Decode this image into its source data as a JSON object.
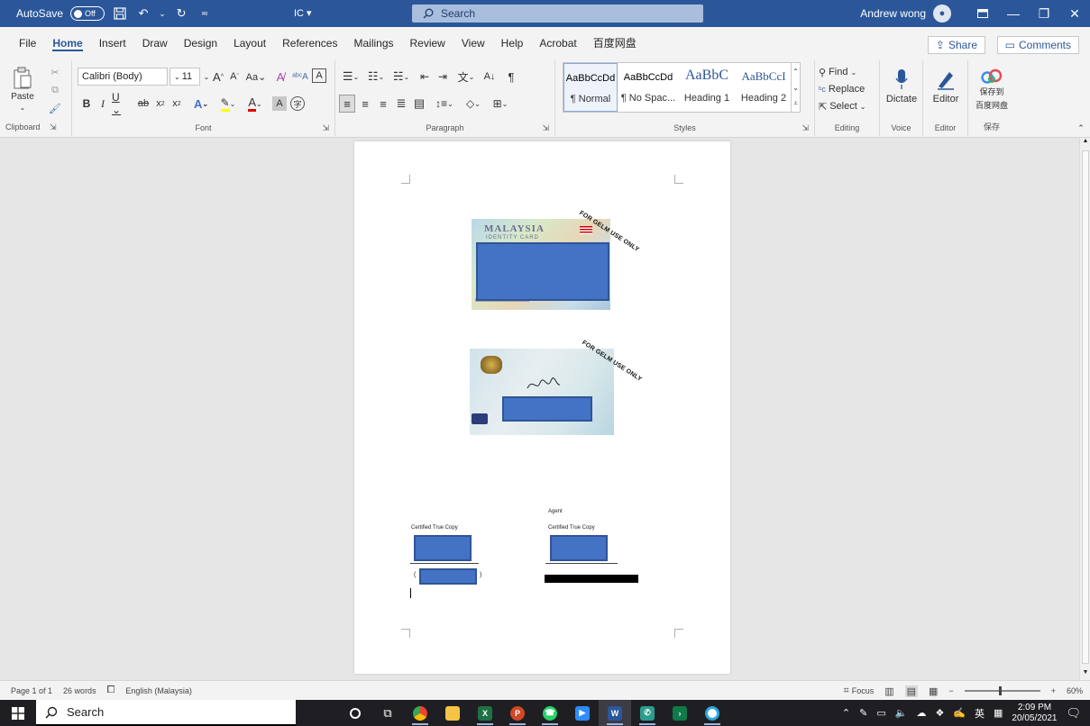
{
  "titlebar": {
    "autosave_label": "AutoSave",
    "autosave_state": "Off",
    "doc_name": "IC",
    "search_placeholder": "Search",
    "user_name": "Andrew wong"
  },
  "tabs": [
    "File",
    "Home",
    "Insert",
    "Draw",
    "Design",
    "Layout",
    "References",
    "Mailings",
    "Review",
    "View",
    "Help",
    "Acrobat",
    "百度网盘"
  ],
  "active_tab": "Home",
  "share_label": "Share",
  "comments_label": "Comments",
  "ribbon": {
    "clipboard": {
      "paste": "Paste",
      "group": "Clipboard"
    },
    "font": {
      "name": "Calibri (Body)",
      "size": "11",
      "group": "Font"
    },
    "paragraph": {
      "group": "Paragraph"
    },
    "styles": {
      "group": "Styles",
      "items": [
        {
          "sample": "AaBbCcDd",
          "name": "¶ Normal"
        },
        {
          "sample": "AaBbCcDd",
          "name": "¶ No Spac..."
        },
        {
          "sample": "AaBbC",
          "name": "Heading 1"
        },
        {
          "sample": "AaBbCcI",
          "name": "Heading 2"
        }
      ]
    },
    "editing": {
      "find": "Find",
      "replace": "Replace",
      "select": "Select",
      "group": "Editing"
    },
    "voice": {
      "dictate": "Dictate",
      "group": "Voice"
    },
    "editor": {
      "editor": "Editor",
      "group": "Editor"
    },
    "save": {
      "label_line1": "保存到",
      "label_line2": "百度网盘",
      "group": "保存"
    }
  },
  "document": {
    "stamp_1": "FOR GELM USE ONLY",
    "stamp_2": "FOR GELM USE ONLY",
    "card_front_title": "MALAYSIA",
    "card_front_sub": "IDENTITY CARD",
    "agent_label": "Agent",
    "certified_left": "Certified True Copy",
    "certified_right": "Certified True Copy"
  },
  "statusbar": {
    "page": "Page 1 of 1",
    "words": "26 words",
    "language": "English (Malaysia)",
    "focus": "Focus",
    "zoom": "60%"
  },
  "taskbar": {
    "search": "Search",
    "ime_lang": "英",
    "time": "2:09 PM",
    "date": "20/05/2021"
  },
  "colors": {
    "word_blue": "#2b579a",
    "redaction_blue": "#4472c4"
  }
}
